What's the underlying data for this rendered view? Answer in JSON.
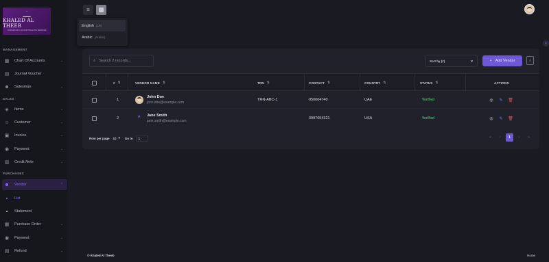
{
  "brand": {
    "name": "KHALED AL THEEB",
    "tagline": "CONSULTANCY ACCOUNTING & TAX SERVICES"
  },
  "sidebar": {
    "sections": [
      {
        "label": "MANAGEMENT"
      },
      {
        "label": "SALES"
      },
      {
        "label": "PURCHASES"
      }
    ],
    "items": [
      {
        "label": "Chart Of Accounts",
        "icon": "chart-icon",
        "chevron": "⌄"
      },
      {
        "label": "Journal Voucher",
        "icon": "document-icon",
        "chevron": ""
      },
      {
        "label": "Salesman",
        "icon": "users-icon",
        "chevron": "⌄"
      },
      {
        "label": "Items",
        "icon": "tag-icon",
        "chevron": "⌄"
      },
      {
        "label": "Customer",
        "icon": "user-icon",
        "chevron": "⌄"
      },
      {
        "label": "Invoice",
        "icon": "invoice-icon",
        "chevron": "⌄"
      },
      {
        "label": "Payment",
        "icon": "payment-icon",
        "chevron": "⌄"
      },
      {
        "label": "Credit Note",
        "icon": "note-icon",
        "chevron": "⌄"
      },
      {
        "label": "Vendor",
        "icon": "vendor-icon",
        "chevron": "⌃"
      },
      {
        "label": "Purchase Order",
        "icon": "cart-icon",
        "chevron": "⌄"
      },
      {
        "label": "Payment",
        "icon": "payment-icon",
        "chevron": "⌄"
      },
      {
        "label": "Refund",
        "icon": "refund-icon",
        "chevron": "⌄"
      }
    ],
    "subitems": [
      {
        "label": "List"
      },
      {
        "label": "Statement"
      }
    ]
  },
  "language_menu": {
    "options": [
      {
        "label": "English",
        "code": "(UK)"
      },
      {
        "label": "Arabic",
        "code": "(Arabic)"
      }
    ]
  },
  "toolbar": {
    "search_placeholder": "Search 2 records...",
    "sort_label": "Sort by (#)",
    "add_label": "Add Vendor"
  },
  "table": {
    "headers": [
      "#",
      "VENDOR NAME",
      "TRN",
      "CONTACT",
      "COUNTRY",
      "STATUS",
      "ACTIONS"
    ],
    "rows": [
      {
        "num": "1",
        "name": "John Doe",
        "email": "john.doe@example.com",
        "trn": "TRN-ABC-1",
        "contact": "050004740",
        "country": "UAE",
        "status": "Verified",
        "initial": ""
      },
      {
        "num": "2",
        "name": "Jane Smith",
        "email": "jane.smith@example.com",
        "trn": "",
        "contact": "0997654321",
        "country": "USA",
        "status": "Verified",
        "initial": "A"
      }
    ]
  },
  "pagination": {
    "rows_per_page_label": "Row per page",
    "rows_per_page": "10",
    "goto_label": "Go to",
    "goto_value": "1",
    "current_page": "1"
  },
  "footer": {
    "copyright": "© Khaled Al Theeb",
    "home": "Home"
  },
  "colors": {
    "accent": "#6e58d6",
    "status_verified": "#4caf6a",
    "delete": "#e45656"
  }
}
